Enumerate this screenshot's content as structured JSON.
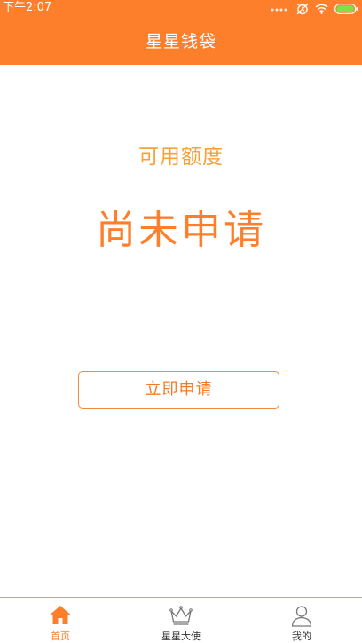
{
  "status_bar": {
    "time": "下午2:07",
    "icons": [
      "signal-dots-icon",
      "alarm-icon",
      "wifi-icon",
      "battery-icon"
    ]
  },
  "header": {
    "title": "星星钱袋",
    "background": "#fd7f2c"
  },
  "main": {
    "credit_label": "可用额度",
    "credit_value": "尚未申请",
    "apply_button": "立即申请"
  },
  "tabbar": {
    "items": [
      {
        "label": "首页",
        "icon": "home-icon",
        "active": true
      },
      {
        "label": "星星大使",
        "icon": "crown-icon",
        "active": false
      },
      {
        "label": "我的",
        "icon": "user-icon",
        "active": false
      }
    ]
  },
  "colors": {
    "accent": "#fd7f2c",
    "label": "#f6a23a",
    "inactive_text": "#333333"
  }
}
